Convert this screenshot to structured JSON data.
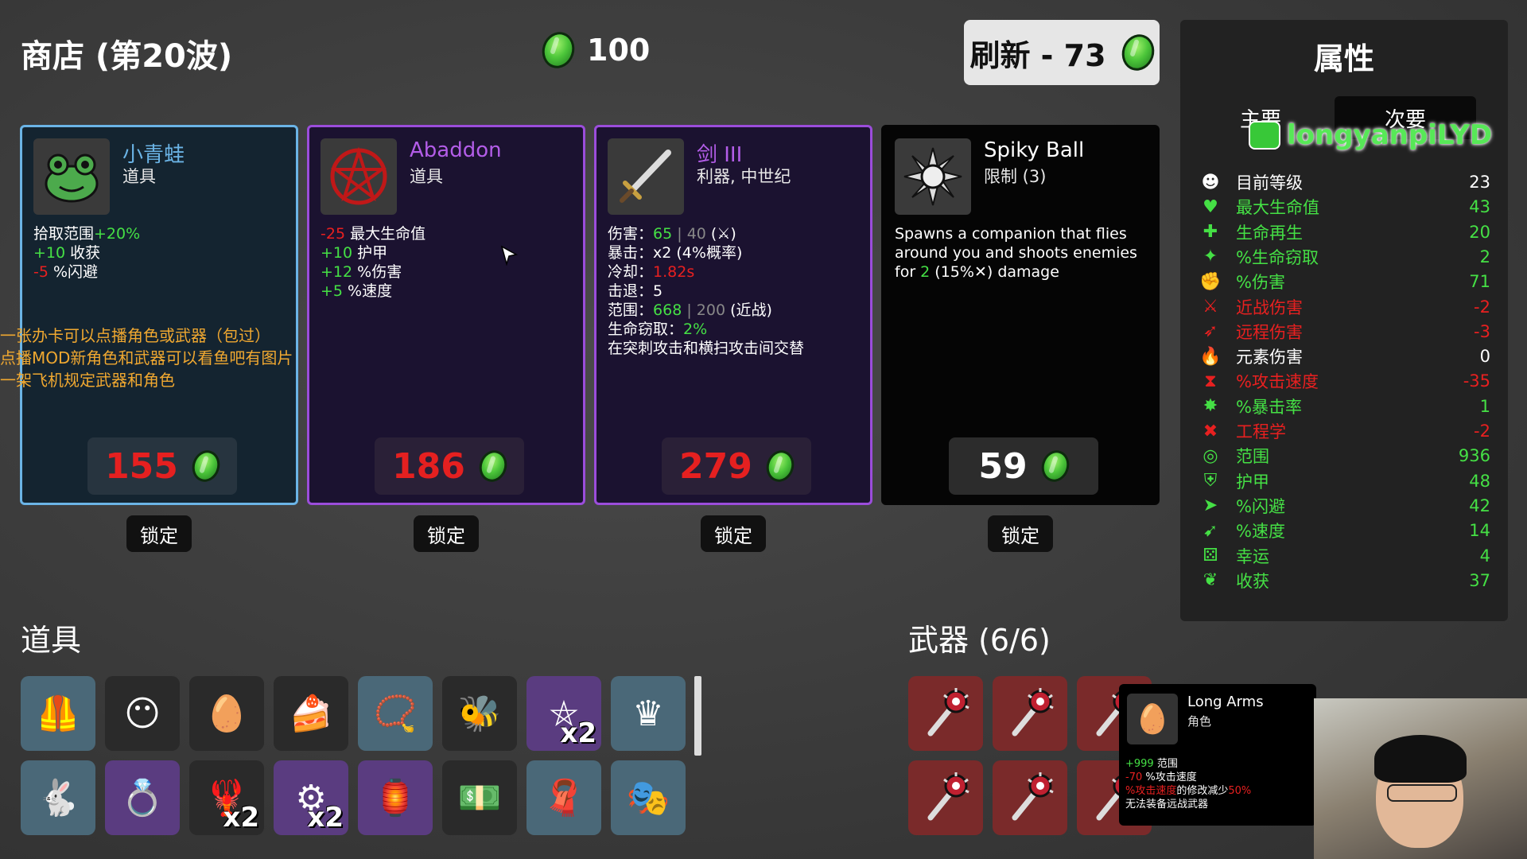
{
  "header": {
    "shop_title": "商店 (第20波)",
    "money": "100",
    "refresh_label": "刷新 - 73"
  },
  "cards": [
    {
      "name": "小青蛙",
      "type": "道具",
      "icon": "frog-icon",
      "price": "155",
      "stats": [
        [
          "拾取范围",
          "+20%",
          ""
        ],
        [
          "+10",
          " 收获",
          ""
        ],
        [
          "-5",
          " %闪避",
          ""
        ]
      ]
    },
    {
      "name": "Abaddon",
      "type": "道具",
      "icon": "pentagram-icon",
      "price": "186",
      "stats": [
        [
          "-25",
          " 最大生命值"
        ],
        [
          "+10",
          " 护甲"
        ],
        [
          "+12",
          " %伤害"
        ],
        [
          "+5",
          " %速度"
        ]
      ]
    },
    {
      "name": "剑 III",
      "type": "利器, 中世纪",
      "icon": "sword-icon",
      "price": "279",
      "lines": {
        "damage_label": "伤害：",
        "damage_val": "65",
        "damage_base": "40",
        "damage_tail": "(⚔)",
        "crit_label": "暴击：",
        "crit_val": "x2 (4%概率)",
        "cooldown_label": "冷却：",
        "cooldown_val": "1.82s",
        "knockback_label": "击退：",
        "knockback_val": "5",
        "range_label": "范围：",
        "range_val": "668",
        "range_base": "200",
        "range_tail": "(近战)",
        "lifesteal_label": "生命窃取：",
        "lifesteal_val": "2%",
        "desc": "在突刺攻击和横扫攻击间交替"
      }
    },
    {
      "name": "Spiky Ball",
      "type": "限制 (3)",
      "icon": "spiky-ball-icon",
      "price": "59",
      "desc_a": "Spawns a companion that flies around you and shoots enemies for ",
      "desc_val": "2",
      "desc_b": " (15%✕) damage"
    }
  ],
  "lock_label": "锁定",
  "overlay_text": [
    "一张办卡可以点播角色或武器（包过）",
    "点播MOD新角色和武器可以看鱼吧有图片",
    "一架飞机规定武器和角色"
  ],
  "stats_panel": {
    "title": "属性",
    "tab_main": "主要",
    "tab_secondary": "次要",
    "rows": [
      {
        "label": "目前等级",
        "value": "23",
        "icon": "level-icon",
        "color": "#ffffff"
      },
      {
        "label": "最大生命值",
        "value": "43",
        "icon": "heart-icon",
        "color": "#45e045"
      },
      {
        "label": "生命再生",
        "value": "20",
        "icon": "regen-icon",
        "color": "#45e045"
      },
      {
        "label": "%生命窃取",
        "value": "2",
        "icon": "lifesteal-icon",
        "color": "#45e045"
      },
      {
        "label": "%伤害",
        "value": "71",
        "icon": "damage-icon",
        "color": "#45e045"
      },
      {
        "label": "近战伤害",
        "value": "-2",
        "icon": "melee-icon",
        "color": "#e82020"
      },
      {
        "label": "远程伤害",
        "value": "-3",
        "icon": "ranged-icon",
        "color": "#e82020"
      },
      {
        "label": "元素伤害",
        "value": "0",
        "icon": "elemental-icon",
        "color": "#ffffff"
      },
      {
        "label": "%攻击速度",
        "value": "-35",
        "icon": "attack-speed-icon",
        "color": "#e82020"
      },
      {
        "label": "%暴击率",
        "value": "1",
        "icon": "crit-icon",
        "color": "#45e045"
      },
      {
        "label": "工程学",
        "value": "-2",
        "icon": "engineering-icon",
        "color": "#e82020"
      },
      {
        "label": "范围",
        "value": "936",
        "icon": "range-icon",
        "color": "#45e045"
      },
      {
        "label": "护甲",
        "value": "48",
        "icon": "armor-icon",
        "color": "#45e045"
      },
      {
        "label": "%闪避",
        "value": "42",
        "icon": "dodge-icon",
        "color": "#45e045"
      },
      {
        "label": "%速度",
        "value": "14",
        "icon": "speed-icon",
        "color": "#45e045"
      },
      {
        "label": "幸运",
        "value": "4",
        "icon": "luck-icon",
        "color": "#45e045"
      },
      {
        "label": "收获",
        "value": "37",
        "icon": "harvesting-icon",
        "color": "#45e045"
      }
    ]
  },
  "watermark": "longyanpiLYD",
  "items_title": "道具",
  "weapons_title": "武器 (6/6)",
  "items": [
    {
      "icon": "leather-vest-icon",
      "bg": "blue",
      "count": ""
    },
    {
      "icon": "mummy-icon",
      "bg": "gray",
      "count": ""
    },
    {
      "icon": "egg-icon",
      "bg": "gray",
      "count": ""
    },
    {
      "icon": "cake-icon",
      "bg": "gray",
      "count": ""
    },
    {
      "icon": "pendant-icon",
      "bg": "blue",
      "count": ""
    },
    {
      "icon": "bee-icon",
      "bg": "gray",
      "count": ""
    },
    {
      "icon": "pentagram-icon",
      "bg": "purple",
      "count": "x2"
    },
    {
      "icon": "crown-icon",
      "bg": "blue",
      "count": ""
    },
    {
      "icon": "rabbit-icon",
      "bg": "blue",
      "count": ""
    },
    {
      "icon": "ring-icon",
      "bg": "purple",
      "count": ""
    },
    {
      "icon": "claw-icon",
      "bg": "gray",
      "count": "x2"
    },
    {
      "icon": "turret-icon",
      "bg": "purple",
      "count": "x2"
    },
    {
      "icon": "lantern-icon",
      "bg": "purple",
      "count": ""
    },
    {
      "icon": "banknote-icon",
      "bg": "gray",
      "count": ""
    },
    {
      "icon": "scarf-icon",
      "bg": "blue",
      "count": ""
    },
    {
      "icon": "mask-icon",
      "bg": "blue",
      "count": ""
    }
  ],
  "weapons_icon": "spiked-mace-icon",
  "tooltip": {
    "name": "Long Arms",
    "type": "角色",
    "line1_val": "+999",
    "line1_lbl": " 范围",
    "line2_val": "-70",
    "line2_lbl": " %攻击速度",
    "line3_red": "%攻击速度",
    "line3_mid": "的修改减少",
    "line3_val": "50%",
    "line4": "无法装备远战武器"
  }
}
